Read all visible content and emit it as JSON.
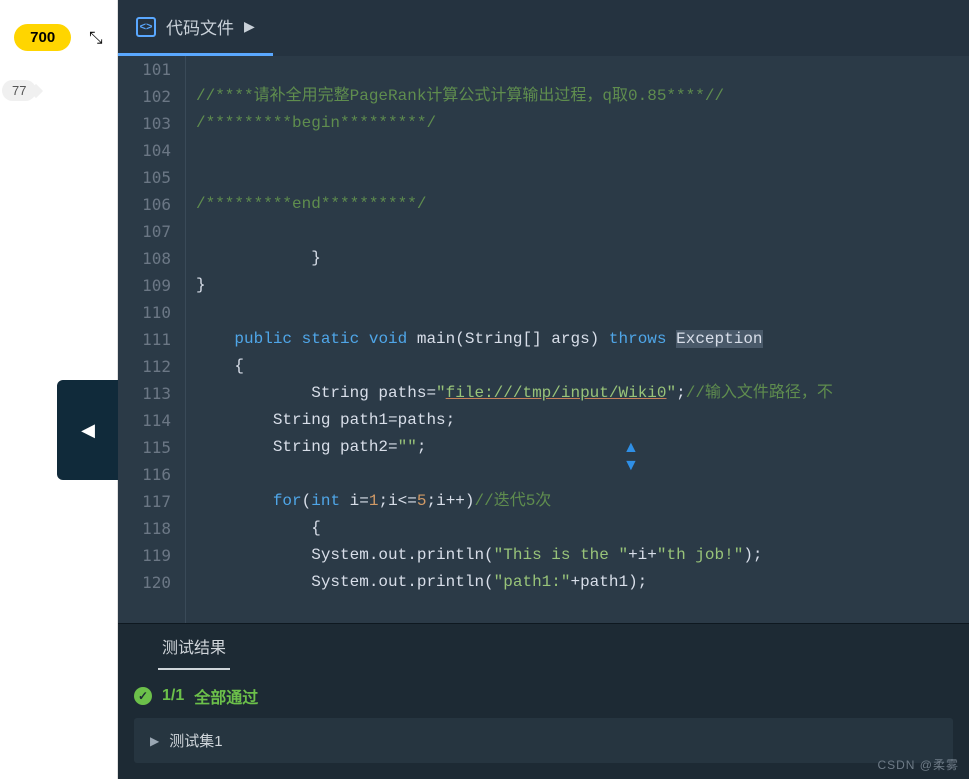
{
  "sidebar": {
    "pill": "700",
    "bubble": "77"
  },
  "tab": {
    "label": "代码文件",
    "icon_text": "<>"
  },
  "lines": [
    {
      "n": "101",
      "indent": 0,
      "html": ""
    },
    {
      "n": "102",
      "indent": 0,
      "html": "<span class='c-cmt2'>//****请补全用完整PageRank计算公式计算输出过程，q取0.85****//</span>"
    },
    {
      "n": "103",
      "indent": 0,
      "html": "<span class='c-cmt2'>/*********begin*********/</span>"
    },
    {
      "n": "104",
      "indent": 0,
      "html": ""
    },
    {
      "n": "105",
      "indent": 0,
      "html": ""
    },
    {
      "n": "106",
      "indent": 0,
      "html": "<span class='c-cmt2'>/*********end**********/</span>"
    },
    {
      "n": "107",
      "indent": 0,
      "html": ""
    },
    {
      "n": "108",
      "indent": 0,
      "html": "            }"
    },
    {
      "n": "109",
      "indent": 0,
      "html": "}"
    },
    {
      "n": "110",
      "indent": 0,
      "html": ""
    },
    {
      "n": "111",
      "indent": 0,
      "html": "    <span class='c-kw'>public</span> <span class='c-kw'>static</span> <span class='c-kw'>void</span> main(String[] args) <span class='c-kw'>throws</span> <span class='c-hl'>Exception</span>"
    },
    {
      "n": "112",
      "indent": 0,
      "html": "    {"
    },
    {
      "n": "113",
      "indent": 0,
      "html": "            String paths=<span class='c-str'>\"</span><span class='c-link'>file:///tmp/input/Wiki0</span><span class='c-str'>\"</span>;<span class='c-cmt2'>//输入文件路径，不</span>"
    },
    {
      "n": "114",
      "indent": 0,
      "html": "        String path1=paths;"
    },
    {
      "n": "115",
      "indent": 0,
      "html": "        String path2=<span class='c-str'>\"\"</span>;"
    },
    {
      "n": "116",
      "indent": 0,
      "html": ""
    },
    {
      "n": "117",
      "indent": 0,
      "html": "        <span class='c-kw'>for</span>(<span class='c-kw'>int</span> i=<span class='c-num'>1</span>;i&lt;=<span class='c-num'>5</span>;i++)<span class='c-cmt2'>//迭代5次</span>"
    },
    {
      "n": "118",
      "indent": 0,
      "html": "            {"
    },
    {
      "n": "119",
      "indent": 0,
      "html": "            System.out.println(<span class='c-str'>\"This is the \"</span>+i+<span class='c-str'>\"th job!\"</span>);"
    },
    {
      "n": "120",
      "indent": 0,
      "html": "            System.out.println(<span class='c-str'>\"path1:\"</span>+path1);"
    }
  ],
  "results": {
    "tab": "测试结果",
    "score": "1/1",
    "all_pass": "全部通过",
    "set1": "测试集1"
  },
  "watermark": "CSDN @柔雾"
}
